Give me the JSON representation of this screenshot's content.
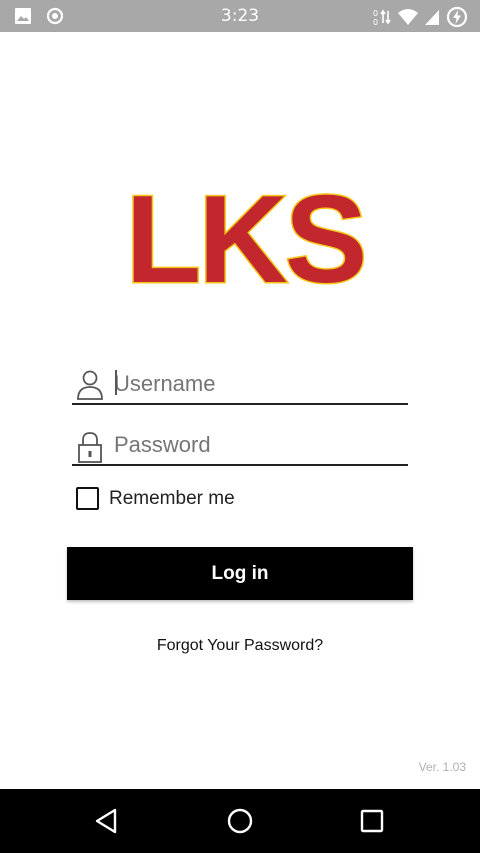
{
  "status_bar": {
    "time": "3:23",
    "icons": [
      "image-icon",
      "record-icon",
      "data-transfer-icon",
      "wifi-icon",
      "signal-icon",
      "battery-charging-icon"
    ]
  },
  "logo": {
    "text": "LKS",
    "fill_color": "#c1272d",
    "outline_color": "#f5c518"
  },
  "login_form": {
    "username_placeholder": "Username",
    "password_placeholder": "Password",
    "remember_label": "Remember me",
    "remember_checked": false,
    "login_label": "Log in",
    "forgot_label": "Forgot Your Password?"
  },
  "version": "Ver. 1.03",
  "nav_bar": {
    "buttons": [
      "back-icon",
      "home-icon",
      "recents-icon"
    ]
  }
}
